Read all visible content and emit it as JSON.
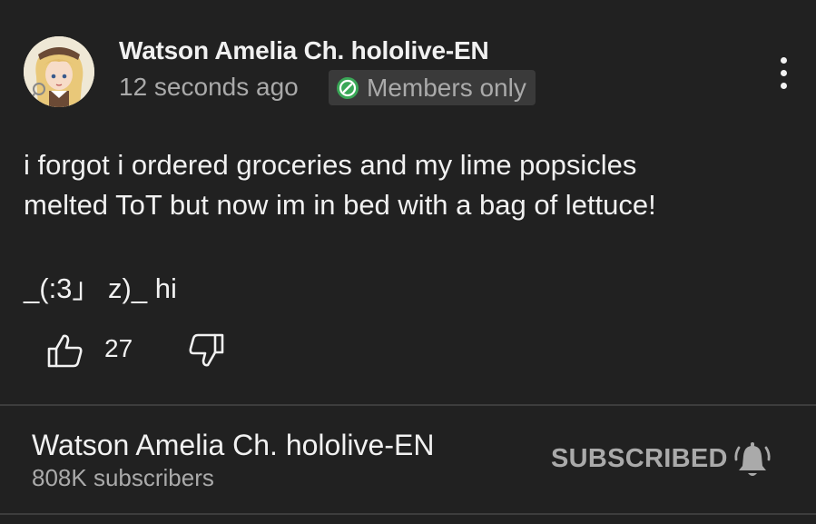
{
  "post": {
    "author": "Watson Amelia Ch. hololive-EN",
    "time": "12 seconds ago",
    "badge": "Members only",
    "badge_icon": "members-badge-icon",
    "body_line1": "i forgot i ordered groceries and my lime popsicles",
    "body_line2": "melted ToT but now im in bed with a bag of lettuce!",
    "body_line3": "_(:3」 z)_ hi",
    "likes": "27"
  },
  "channel": {
    "name": "Watson Amelia Ch. hololive-EN",
    "subscribers": "808K subscribers",
    "subscribe_label": "SUBSCRIBED"
  },
  "colors": {
    "background": "#212121",
    "text_primary": "#f1f1f1",
    "text_secondary": "#aaaaaa",
    "badge_bg": "#3a3a3a",
    "badge_icon": "#3aa757"
  }
}
